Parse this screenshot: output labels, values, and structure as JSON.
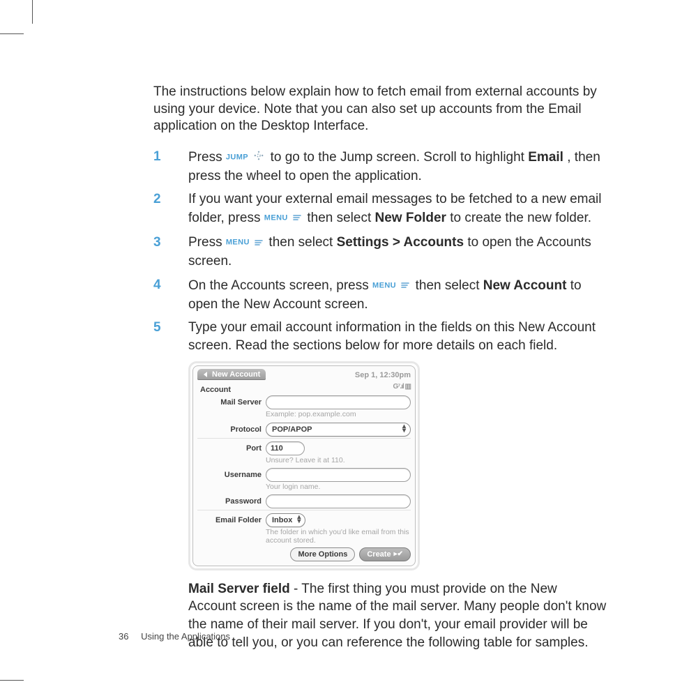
{
  "page": {
    "number": "36",
    "section": "Using the Applications"
  },
  "intro": "The instructions below explain how to fetch email from external accounts by using your device. Note that you can also set up accounts from the Email application on the Desktop Interface.",
  "labels": {
    "jump": "JUMP",
    "menu": "MENU"
  },
  "steps": {
    "1": {
      "pre": "Press ",
      "mid": " to go to the Jump screen. Scroll to highlight ",
      "bold": "Email",
      "post": ", then press the wheel to open the application."
    },
    "2": {
      "pre": "If you want your external email messages to be fetched to a new email folder, press ",
      "mid": " then select ",
      "bold": "New Folder",
      "post": " to create the new folder."
    },
    "3": {
      "pre": "Press ",
      "mid": "  then select ",
      "bold": "Settings > Accounts",
      "post": " to open the Accounts screen."
    },
    "4": {
      "pre": "On the Accounts screen, press ",
      "mid": " then select ",
      "bold": "New Account",
      "post": " to open the New Account screen."
    },
    "5": {
      "text": "Type your email account information in the fields on this New Account screen. Read the sections below for more details on each field."
    }
  },
  "screenshot": {
    "tab_title": "New Account",
    "clock": "Sep 1, 12:30pm",
    "section": "Account",
    "fields": {
      "mail_server": {
        "label": "Mail Server",
        "hint": "Example: pop.example.com"
      },
      "protocol": {
        "label": "Protocol",
        "value": "POP/APOP"
      },
      "port": {
        "label": "Port",
        "value": "110",
        "hint": "Unsure? Leave it at 110."
      },
      "username": {
        "label": "Username",
        "hint": "Your login name."
      },
      "password": {
        "label": "Password"
      },
      "email_folder": {
        "label": "Email Folder",
        "value": "Inbox",
        "hint": "The folder in which you'd like email from this account stored."
      }
    },
    "buttons": {
      "more": "More Options",
      "create": "Create"
    }
  },
  "mailserver": {
    "heading": "Mail Server field",
    "text": " - The first thing you must provide on the New Account screen is the name of the mail server. Many people don't know the name of their mail server. If you don't, your email provider will be able to tell you, or you can reference the following table for samples."
  }
}
